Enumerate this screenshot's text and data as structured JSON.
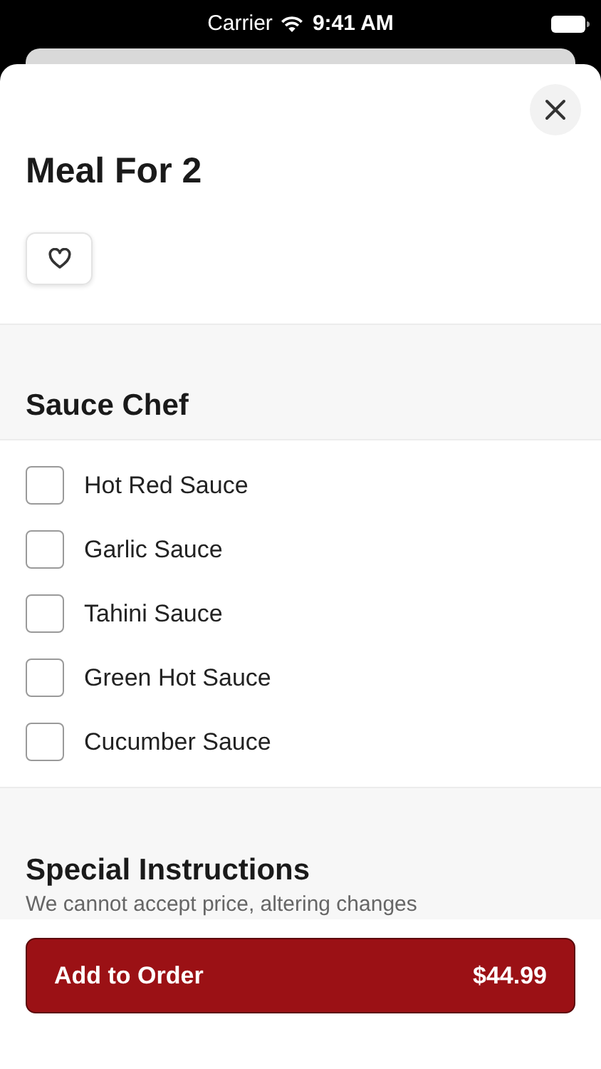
{
  "status_bar": {
    "carrier": "Carrier",
    "time": "9:41 AM"
  },
  "title": "Meal For 2",
  "favorite": {
    "selected": false
  },
  "section": {
    "title": "Sauce Chef",
    "options": [
      {
        "label": "Hot Red Sauce",
        "checked": false
      },
      {
        "label": "Garlic Sauce",
        "checked": false
      },
      {
        "label": "Tahini Sauce",
        "checked": false
      },
      {
        "label": "Green Hot Sauce",
        "checked": false
      },
      {
        "label": "Cucumber Sauce",
        "checked": false
      }
    ]
  },
  "special_instructions": {
    "title": "Special Instructions",
    "note": "We cannot accept price, altering changes"
  },
  "add_button": {
    "label": "Add to Order",
    "price": "$44.99"
  }
}
